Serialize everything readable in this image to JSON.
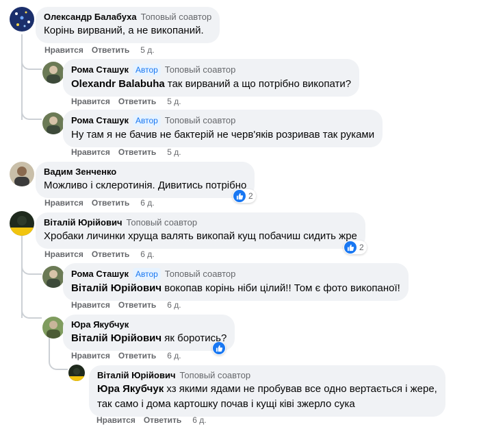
{
  "labels": {
    "like": "Нравится",
    "reply": "Ответить"
  },
  "comments": [
    {
      "name": "Олександр Балабуха",
      "badge": "Топовый соавтор",
      "text": "Корінь вирваний, а не викопаний.",
      "time": "5 д."
    },
    {
      "name": "Рома Сташук",
      "author_badge": "Автор",
      "badge": "Топовый соавтор",
      "mention": "Olexandr Balabuha",
      "text": " так вирваний а що потрібно викопати?",
      "time": "5 д."
    },
    {
      "name": "Рома Сташук",
      "author_badge": "Автор",
      "badge": "Топовый соавтор",
      "text": "Ну там я не бачив не бактерій не черв'яків розривав так руками",
      "time": "5 д."
    },
    {
      "name": "Вадим Зенченко",
      "text": "Можливо і склеротинія. Дивитись потрібно",
      "time": "6 д.",
      "reactions": "2"
    },
    {
      "name": "Віталій Юрійович",
      "badge": "Топовый соавтор",
      "text": "Хробаки личинки хруща валять викопай кущ побачиш сидить жре",
      "time": "6 д.",
      "reactions": "2"
    },
    {
      "name": "Рома Сташук",
      "author_badge": "Автор",
      "badge": "Топовый соавтор",
      "mention": "Віталій Юрійович",
      "text": " вокопав корінь ніби цілий!! Том є фото викопаної!",
      "time": "6 д."
    },
    {
      "name": "Юра Якубчук",
      "mention": "Віталій Юрійович",
      "text": " як боротись?",
      "time": "6 д.",
      "reactions": ""
    },
    {
      "name": "Віталій Юрійович",
      "badge": "Топовый соавтор",
      "mention": "Юра Якубчук",
      "text": " хз якими ядами не пробував все одно вертається і жере,",
      "text2": "так само і дома картошку почав і кущі ківі зжерло сука",
      "time": "6 д."
    }
  ],
  "colors": {
    "bubble": "#f0f2f5",
    "like_blue": "#1877f2",
    "meta_gray": "#65676b",
    "thread_line": "#ccd0d5"
  },
  "icons": {
    "like": "thumbs-up-icon"
  }
}
